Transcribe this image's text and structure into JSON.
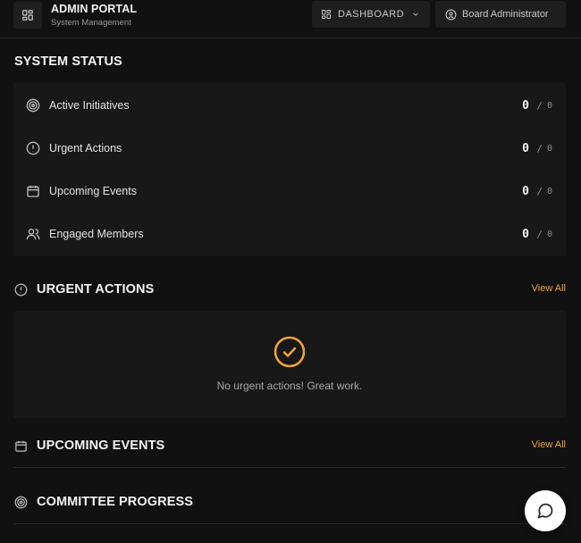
{
  "header": {
    "brand_title": "ADMIN PORTAL",
    "brand_subtitle": "System Management",
    "nav_dashboard_label": "DASHBOARD",
    "nav_user_label": "Board Administrator"
  },
  "system_status": {
    "title": "SYSTEM STATUS",
    "rows": [
      {
        "label": "Active Initiatives",
        "value": "0",
        "separator": "/",
        "total": "0",
        "icon": "target-icon"
      },
      {
        "label": "Urgent Actions",
        "value": "0",
        "separator": "/",
        "total": "0",
        "icon": "alert-circle-icon"
      },
      {
        "label": "Upcoming Events",
        "value": "0",
        "separator": "/",
        "total": "0",
        "icon": "calendar-icon"
      },
      {
        "label": "Engaged Members",
        "value": "0",
        "separator": "/",
        "total": "0",
        "icon": "users-icon"
      }
    ]
  },
  "urgent_actions": {
    "title": "URGENT ACTIONS",
    "view_all": "View All",
    "empty_message": "No urgent actions! Great work."
  },
  "upcoming_events": {
    "title": "UPCOMING EVENTS",
    "view_all": "View All"
  },
  "committee_progress": {
    "title": "COMMITTEE PROGRESS"
  },
  "colors": {
    "accent": "#f0a53a",
    "background": "#111111",
    "card": "#181818"
  }
}
